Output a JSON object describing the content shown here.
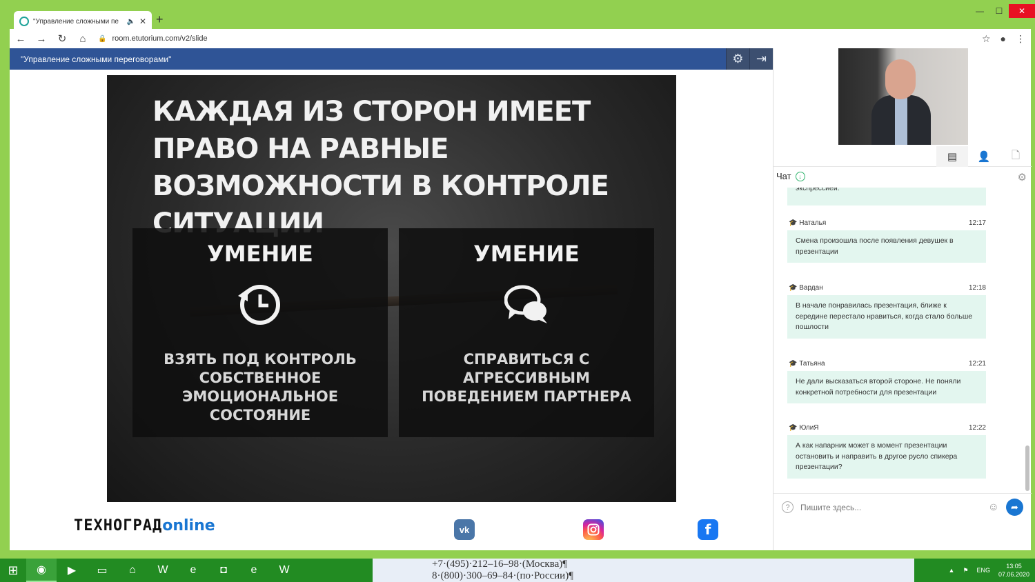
{
  "browser": {
    "tab_title": "\"Управление сложными пе",
    "url": "room.etutorium.com/v2/slide"
  },
  "header": {
    "title": "\"Управление сложными переговорами\""
  },
  "slide": {
    "heading": "КАЖДАЯ ИЗ СТОРОН ИМЕЕТ ПРАВО НА РАВНЫЕ ВОЗМОЖНОСТИ В КОНТРОЛЕ СИТУАЦИИ",
    "cards": [
      {
        "title": "УМЕНИЕ",
        "icon": "history-clock-icon",
        "text": "ВЗЯТЬ ПОД КОНТРОЛЬ СОБСТВЕННОЕ ЭМОЦИОНАЛЬНОЕ СОСТОЯНИЕ"
      },
      {
        "title": "УМЕНИЕ",
        "icon": "chat-bubbles-icon",
        "text": "СПРАВИТЬСЯ С АГРЕССИВНЫМ ПОВЕДЕНИЕМ ПАРТНЕРА"
      }
    ]
  },
  "footer": {
    "brand_main": "ТЕХНОГРАД",
    "brand_suffix": "online",
    "social": {
      "vk": "vk",
      "instagram": "instagram",
      "facebook": "f"
    }
  },
  "chat": {
    "title": "Чат",
    "partial_message": "экспрессией.",
    "messages": [
      {
        "author": "Наталья",
        "time": "12:17",
        "text": "Смена произошла после появления девушек в презентации"
      },
      {
        "author": "Вардан",
        "time": "12:18",
        "text": "В начале понравилась презентация, ближе к середине перестало нравиться, когда стало больше пошлости"
      },
      {
        "author": "Татьяна",
        "time": "12:21",
        "text": "Не дали высказаться второй стороне. Не поняли конкретной потребности для презентации"
      },
      {
        "author": "ЮлиЯ",
        "time": "12:22",
        "text": "А как напарник может в момент презентации остановить и направить в другое русло спикера презентации?"
      }
    ],
    "input_placeholder": "Пишите здесь..."
  },
  "taskbar": {
    "doc_line1": "+7·(495)·212–16–98·(Москва)¶",
    "doc_line2": "8·(800)·300–69–84·(по·России)¶",
    "lang": "ENG",
    "time": "13:05",
    "date": "07.06.2020"
  },
  "colors": {
    "header_bg": "#2f5496",
    "bubble_bg": "#e3f6ef",
    "window_frame": "#92d050",
    "taskbar": "#228b22"
  }
}
